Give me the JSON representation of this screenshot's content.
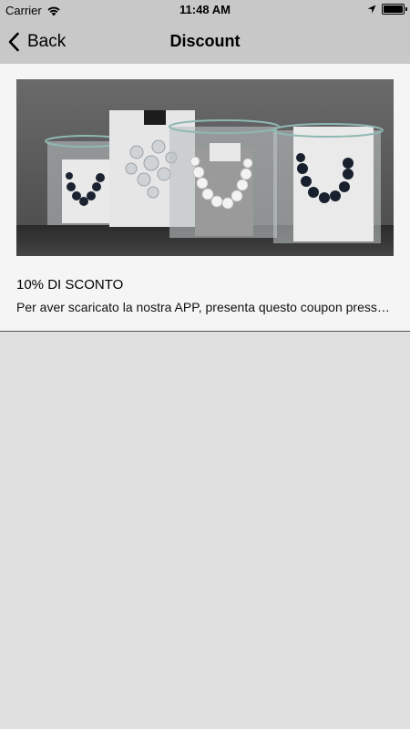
{
  "status_bar": {
    "carrier": "Carrier",
    "time": "11:48 AM"
  },
  "nav": {
    "back_label": "Back",
    "title": "Discount"
  },
  "coupon": {
    "title": "10% DI SCONTO",
    "description": "Per aver scaricato la nostra APP, presenta questo coupon presso il nostro punto vendita"
  },
  "colors": {
    "bar_background": "#c8c8c8",
    "page_background": "#e0e0e0",
    "card_background": "#f5f5f5"
  }
}
